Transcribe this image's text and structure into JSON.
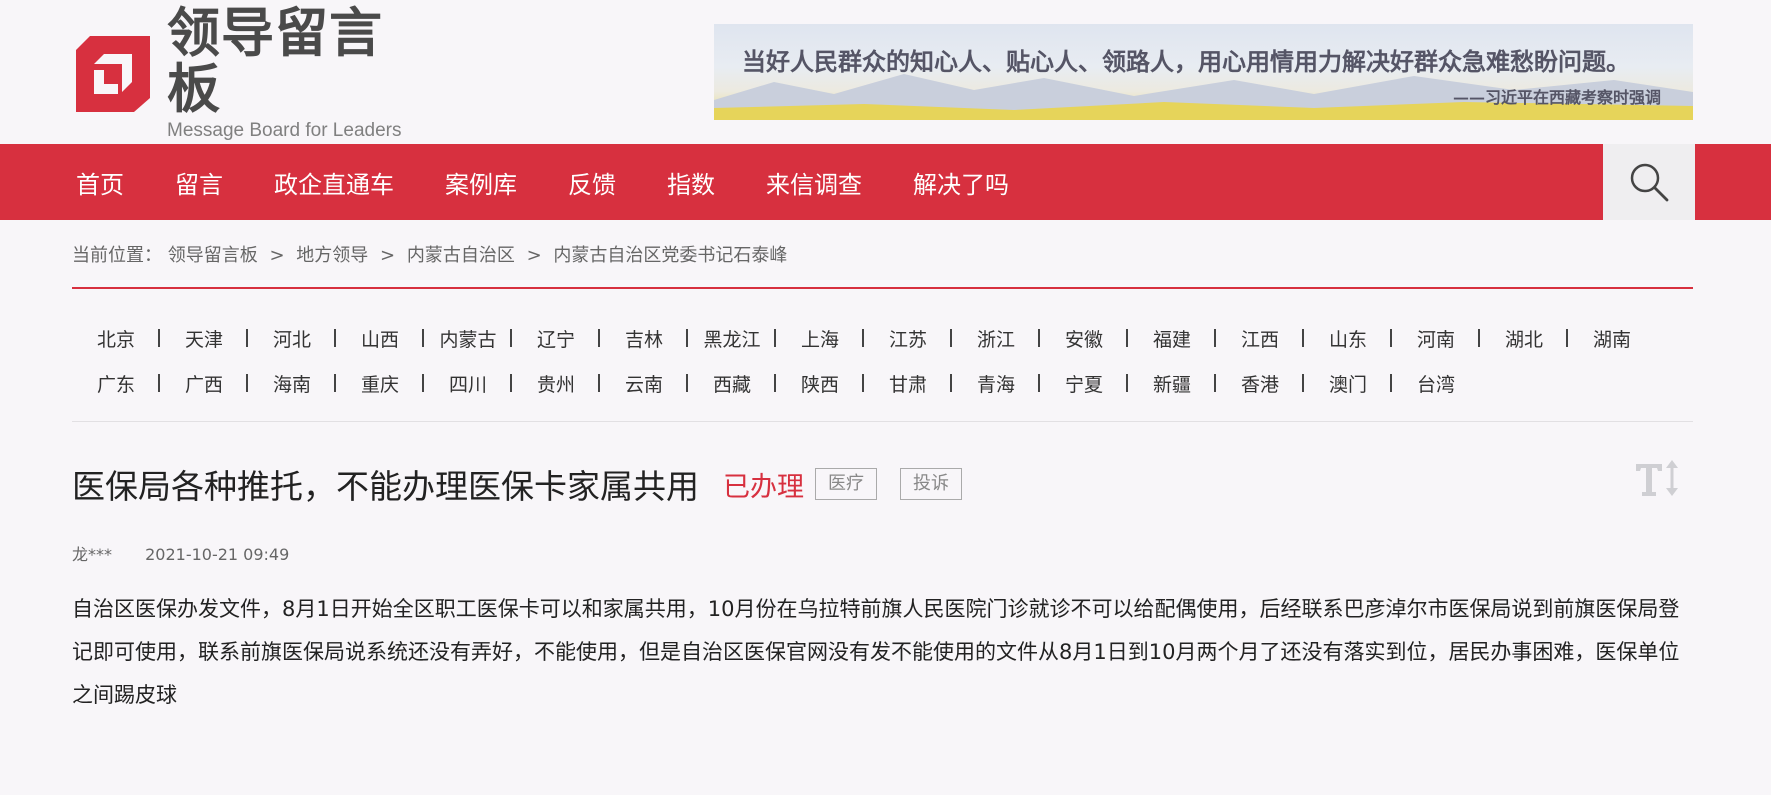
{
  "header": {
    "logo_title": "领导留言板",
    "logo_subtitle": "Message Board for Leaders",
    "banner_quote": "当好人民群众的知心人、贴心人、领路人，用心用情用力解决好群众急难愁盼问题。",
    "banner_source": "——习近平在西藏考察时强调"
  },
  "nav": {
    "items": [
      "首页",
      "留言",
      "政企直通车",
      "案例库",
      "反馈",
      "指数",
      "来信调查",
      "解决了吗"
    ],
    "search_icon": "search-icon"
  },
  "breadcrumb": {
    "label": "当前位置：",
    "items": [
      "领导留言板",
      "地方领导",
      "内蒙古自治区",
      "内蒙古自治区党委书记石泰峰"
    ],
    "separator": ">"
  },
  "regions": {
    "row1": [
      "北京",
      "天津",
      "河北",
      "山西",
      "内蒙古",
      "辽宁",
      "吉林",
      "黑龙江",
      "上海",
      "江苏",
      "浙江",
      "安徽",
      "福建",
      "江西",
      "山东",
      "河南",
      "湖北",
      "湖南"
    ],
    "row2": [
      "广东",
      "广西",
      "海南",
      "重庆",
      "四川",
      "贵州",
      "云南",
      "西藏",
      "陕西",
      "甘肃",
      "青海",
      "宁夏",
      "新疆",
      "香港",
      "澳门",
      "台湾"
    ]
  },
  "post": {
    "title": "医保局各种推托，不能办理医保卡家属共用",
    "status": "已办理",
    "tags": [
      "医疗",
      "投诉"
    ],
    "author": "龙***",
    "date": "2021-10-21 09:49",
    "body": "自治区医保办发文件，8月1日开始全区职工医保卡可以和家属共用，10月份在乌拉特前旗人民医院门诊就诊不可以给配偶使用，后经联系巴彦淖尔市医保局说到前旗医保局登记即可使用，联系前旗医保局说系统还没有弄好，不能使用，但是自治区医保官网没有发不能使用的文件从8月1日到10月两个月了还没有落实到位，居民办事困难，医保单位之间踢皮球"
  },
  "colors": {
    "brand_red": "#d7303f",
    "background": "#f8f6f9"
  }
}
